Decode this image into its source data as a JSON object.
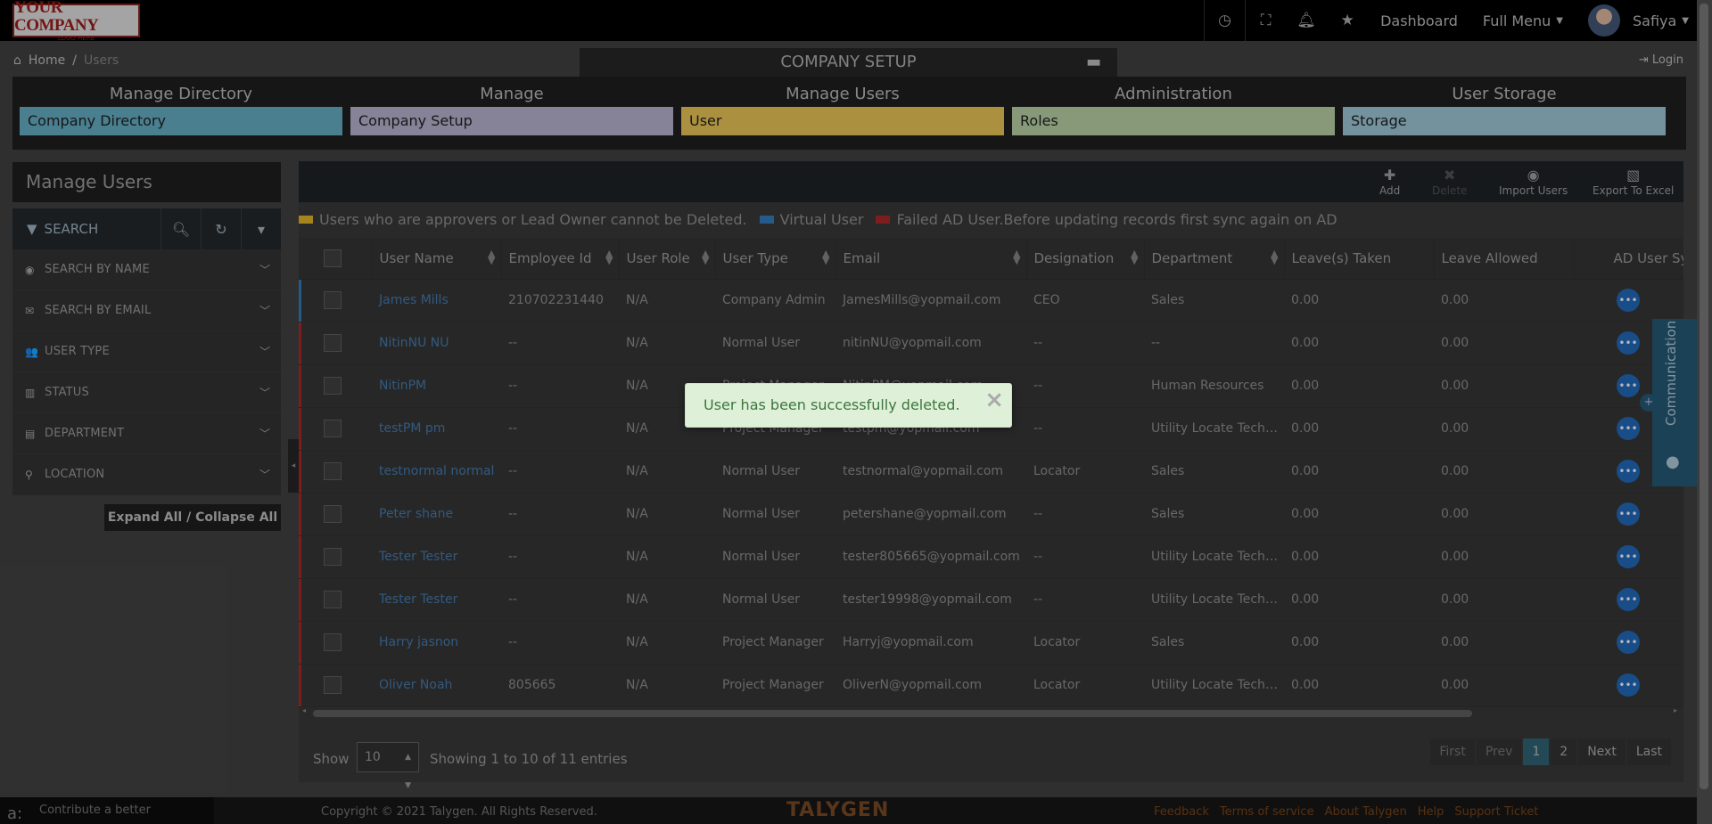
{
  "logo": {
    "line1": "YOUR COMPANY",
    "line2": "LOGO HERE"
  },
  "topbar": {
    "dashboard": "Dashboard",
    "full_menu": "Full Menu",
    "user": "Safiya"
  },
  "breadcrumb": {
    "home": "Home",
    "sep": "/",
    "current": "Users"
  },
  "login": "Login",
  "setup": {
    "title": "COMPANY SETUP",
    "columns": [
      {
        "header": "Manage Directory",
        "item": "Company Directory",
        "color": "#5b9bb0"
      },
      {
        "header": "Manage",
        "item": "Company Setup",
        "color": "#a49fb9"
      },
      {
        "header": "Manage Users",
        "item": "User",
        "color": "#d1b04d"
      },
      {
        "header": "Administration",
        "item": "Roles",
        "color": "#a5bb94"
      },
      {
        "header": "User Storage",
        "item": "Storage",
        "color": "#8db3c0"
      }
    ]
  },
  "sidebar": {
    "title": "Manage Users",
    "search_label": "SEARCH",
    "filters": [
      {
        "icon": "user-circle-icon",
        "glyph": "◉",
        "label": "SEARCH BY NAME"
      },
      {
        "icon": "envelope-icon",
        "glyph": "✉",
        "label": "SEARCH BY EMAIL"
      },
      {
        "icon": "users-icon",
        "glyph": "👥",
        "label": "USER TYPE"
      },
      {
        "icon": "bar-chart-icon",
        "glyph": "▥",
        "label": "STATUS"
      },
      {
        "icon": "id-card-icon",
        "glyph": "▤",
        "label": "DEPARTMENT"
      },
      {
        "icon": "map-pin-icon",
        "glyph": "⚲",
        "label": "LOCATION"
      }
    ],
    "expand_label": "Expand All / Collapse All"
  },
  "toolbar": {
    "add": "Add",
    "delete": "Delete",
    "import": "Import Users",
    "export": "Export To Excel"
  },
  "legend": {
    "approver": "Users who are approvers or Lead Owner cannot be Deleted.",
    "virtual": "Virtual User",
    "failed": "Failed AD User.Before updating records first sync again on AD",
    "colors": {
      "approver": "#c9a227",
      "virtual": "#2d6fa8",
      "failed": "#9a2424"
    }
  },
  "table": {
    "headers": [
      "User Name",
      "Employee Id",
      "User Role",
      "User Type",
      "Email",
      "Designation",
      "Department",
      "Leave(s) Taken",
      "Leave Allowed",
      "AD User Sy"
    ],
    "rows": [
      {
        "name": "James Mills",
        "emp": "210702231440",
        "role": "N/A",
        "type": "Company Admin",
        "email": "JamesMills@yopmail.com",
        "desig": "CEO",
        "dept": "Sales",
        "taken": "0.00",
        "allowed": "0.00",
        "mark": "virt"
      },
      {
        "name": "NitinNU NU",
        "emp": "--",
        "role": "N/A",
        "type": "Normal User",
        "email": "nitinNU@yopmail.com",
        "desig": "--",
        "dept": "--",
        "taken": "0.00",
        "allowed": "0.00",
        "mark": "fail"
      },
      {
        "name": "NitinPM",
        "emp": "--",
        "role": "N/A",
        "type": "Project Manager",
        "email": "NitinPM@yopmail.com",
        "desig": "--",
        "dept": "Human Resources",
        "taken": "0.00",
        "allowed": "0.00",
        "mark": "fail"
      },
      {
        "name": "testPM pm",
        "emp": "--",
        "role": "N/A",
        "type": "Project Manager",
        "email": "testpm@yopmail.com",
        "desig": "--",
        "dept": "Utility Locate Technician",
        "taken": "0.00",
        "allowed": "0.00",
        "mark": "fail"
      },
      {
        "name": "testnormal normal",
        "emp": "--",
        "role": "N/A",
        "type": "Normal User",
        "email": "testnormal@yopmail.com",
        "desig": "Locator",
        "dept": "Sales",
        "taken": "0.00",
        "allowed": "0.00",
        "mark": "fail"
      },
      {
        "name": "Peter shane",
        "emp": "--",
        "role": "N/A",
        "type": "Normal User",
        "email": "petershane@yopmail.com",
        "desig": "--",
        "dept": "Sales",
        "taken": "0.00",
        "allowed": "0.00",
        "mark": "fail"
      },
      {
        "name": "Tester Tester",
        "emp": "--",
        "role": "N/A",
        "type": "Normal User",
        "email": "tester805665@yopmail.com",
        "desig": "--",
        "dept": "Utility Locate Technician",
        "taken": "0.00",
        "allowed": "0.00",
        "mark": "fail"
      },
      {
        "name": "Tester Tester",
        "emp": "--",
        "role": "N/A",
        "type": "Normal User",
        "email": "tester19998@yopmail.com",
        "desig": "--",
        "dept": "Utility Locate Technician",
        "taken": "0.00",
        "allowed": "0.00",
        "mark": "fail"
      },
      {
        "name": "Harry jasnon",
        "emp": "--",
        "role": "N/A",
        "type": "Project Manager",
        "email": "Harryj@yopmail.com",
        "desig": "Locator",
        "dept": "Sales",
        "taken": "0.00",
        "allowed": "0.00",
        "mark": "fail"
      },
      {
        "name": "Oliver Noah",
        "emp": "805665",
        "role": "N/A",
        "type": "Project Manager",
        "email": "OliverN@yopmail.com",
        "desig": "Locator",
        "dept": "Utility Locate Technician",
        "taken": "0.00",
        "allowed": "0.00",
        "mark": "fail"
      }
    ]
  },
  "pager": {
    "show": "Show",
    "page_size": "10",
    "info": "Showing 1 to 10 of 11 entries",
    "buttons": [
      "First",
      "Prev",
      "1",
      "2",
      "Next",
      "Last"
    ]
  },
  "communication": "Communication",
  "footer": {
    "translate": "Contribute a better translation",
    "copyright": "Copyright © 2021 Talygen. All Rights Reserved.",
    "brand": "TALYGEN",
    "links": [
      "Feedback",
      "Terms of service",
      "About Talygen",
      "Help",
      "Support Ticket"
    ]
  },
  "toast": {
    "message": "User has been successfully deleted."
  }
}
